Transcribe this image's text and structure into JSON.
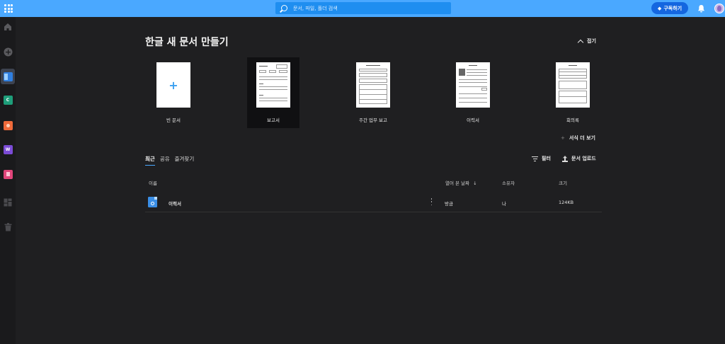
{
  "topbar": {
    "search_placeholder": "문서, 파일, 폴더 검색",
    "subscribe_label": "구독하기"
  },
  "sidebar": {
    "items": [
      {
        "name": "home-icon"
      },
      {
        "name": "add-icon"
      },
      {
        "name": "hangul-docs-app-icon",
        "active": true
      },
      {
        "name": "hancell-app-icon",
        "glyph": "C"
      },
      {
        "name": "hanshow-app-icon"
      },
      {
        "name": "hanword-app-icon",
        "glyph": "W"
      },
      {
        "name": "pdf-app-icon"
      },
      {
        "name": "templates-icon"
      },
      {
        "name": "trash-icon"
      }
    ]
  },
  "main": {
    "title": "한글 새 문서 만들기",
    "collapse_label": "접기",
    "templates": [
      {
        "label": "빈 문서"
      },
      {
        "label": "보고서"
      },
      {
        "label": "주간 업무 보고"
      },
      {
        "label": "이력서"
      },
      {
        "label": "회의록"
      }
    ],
    "more_templates_label": "서식 더 보기",
    "more_templates_prefix": "+",
    "tabs": [
      "최근",
      "공유",
      "즐겨찾기"
    ],
    "filter_label": "필터",
    "upload_label": "문서 업로드",
    "table": {
      "headers": {
        "name": "이름",
        "opened": "열어 본 날짜",
        "owner": "소유자",
        "size": "크기"
      },
      "sort_arrow": "↓",
      "rows": [
        {
          "name": "이력서",
          "opened": "방금",
          "owner": "나",
          "size": "124KB"
        }
      ]
    }
  },
  "colors": {
    "topbar": "#4aa8ff",
    "background": "#1f1f21",
    "accent": "#1466e0"
  }
}
